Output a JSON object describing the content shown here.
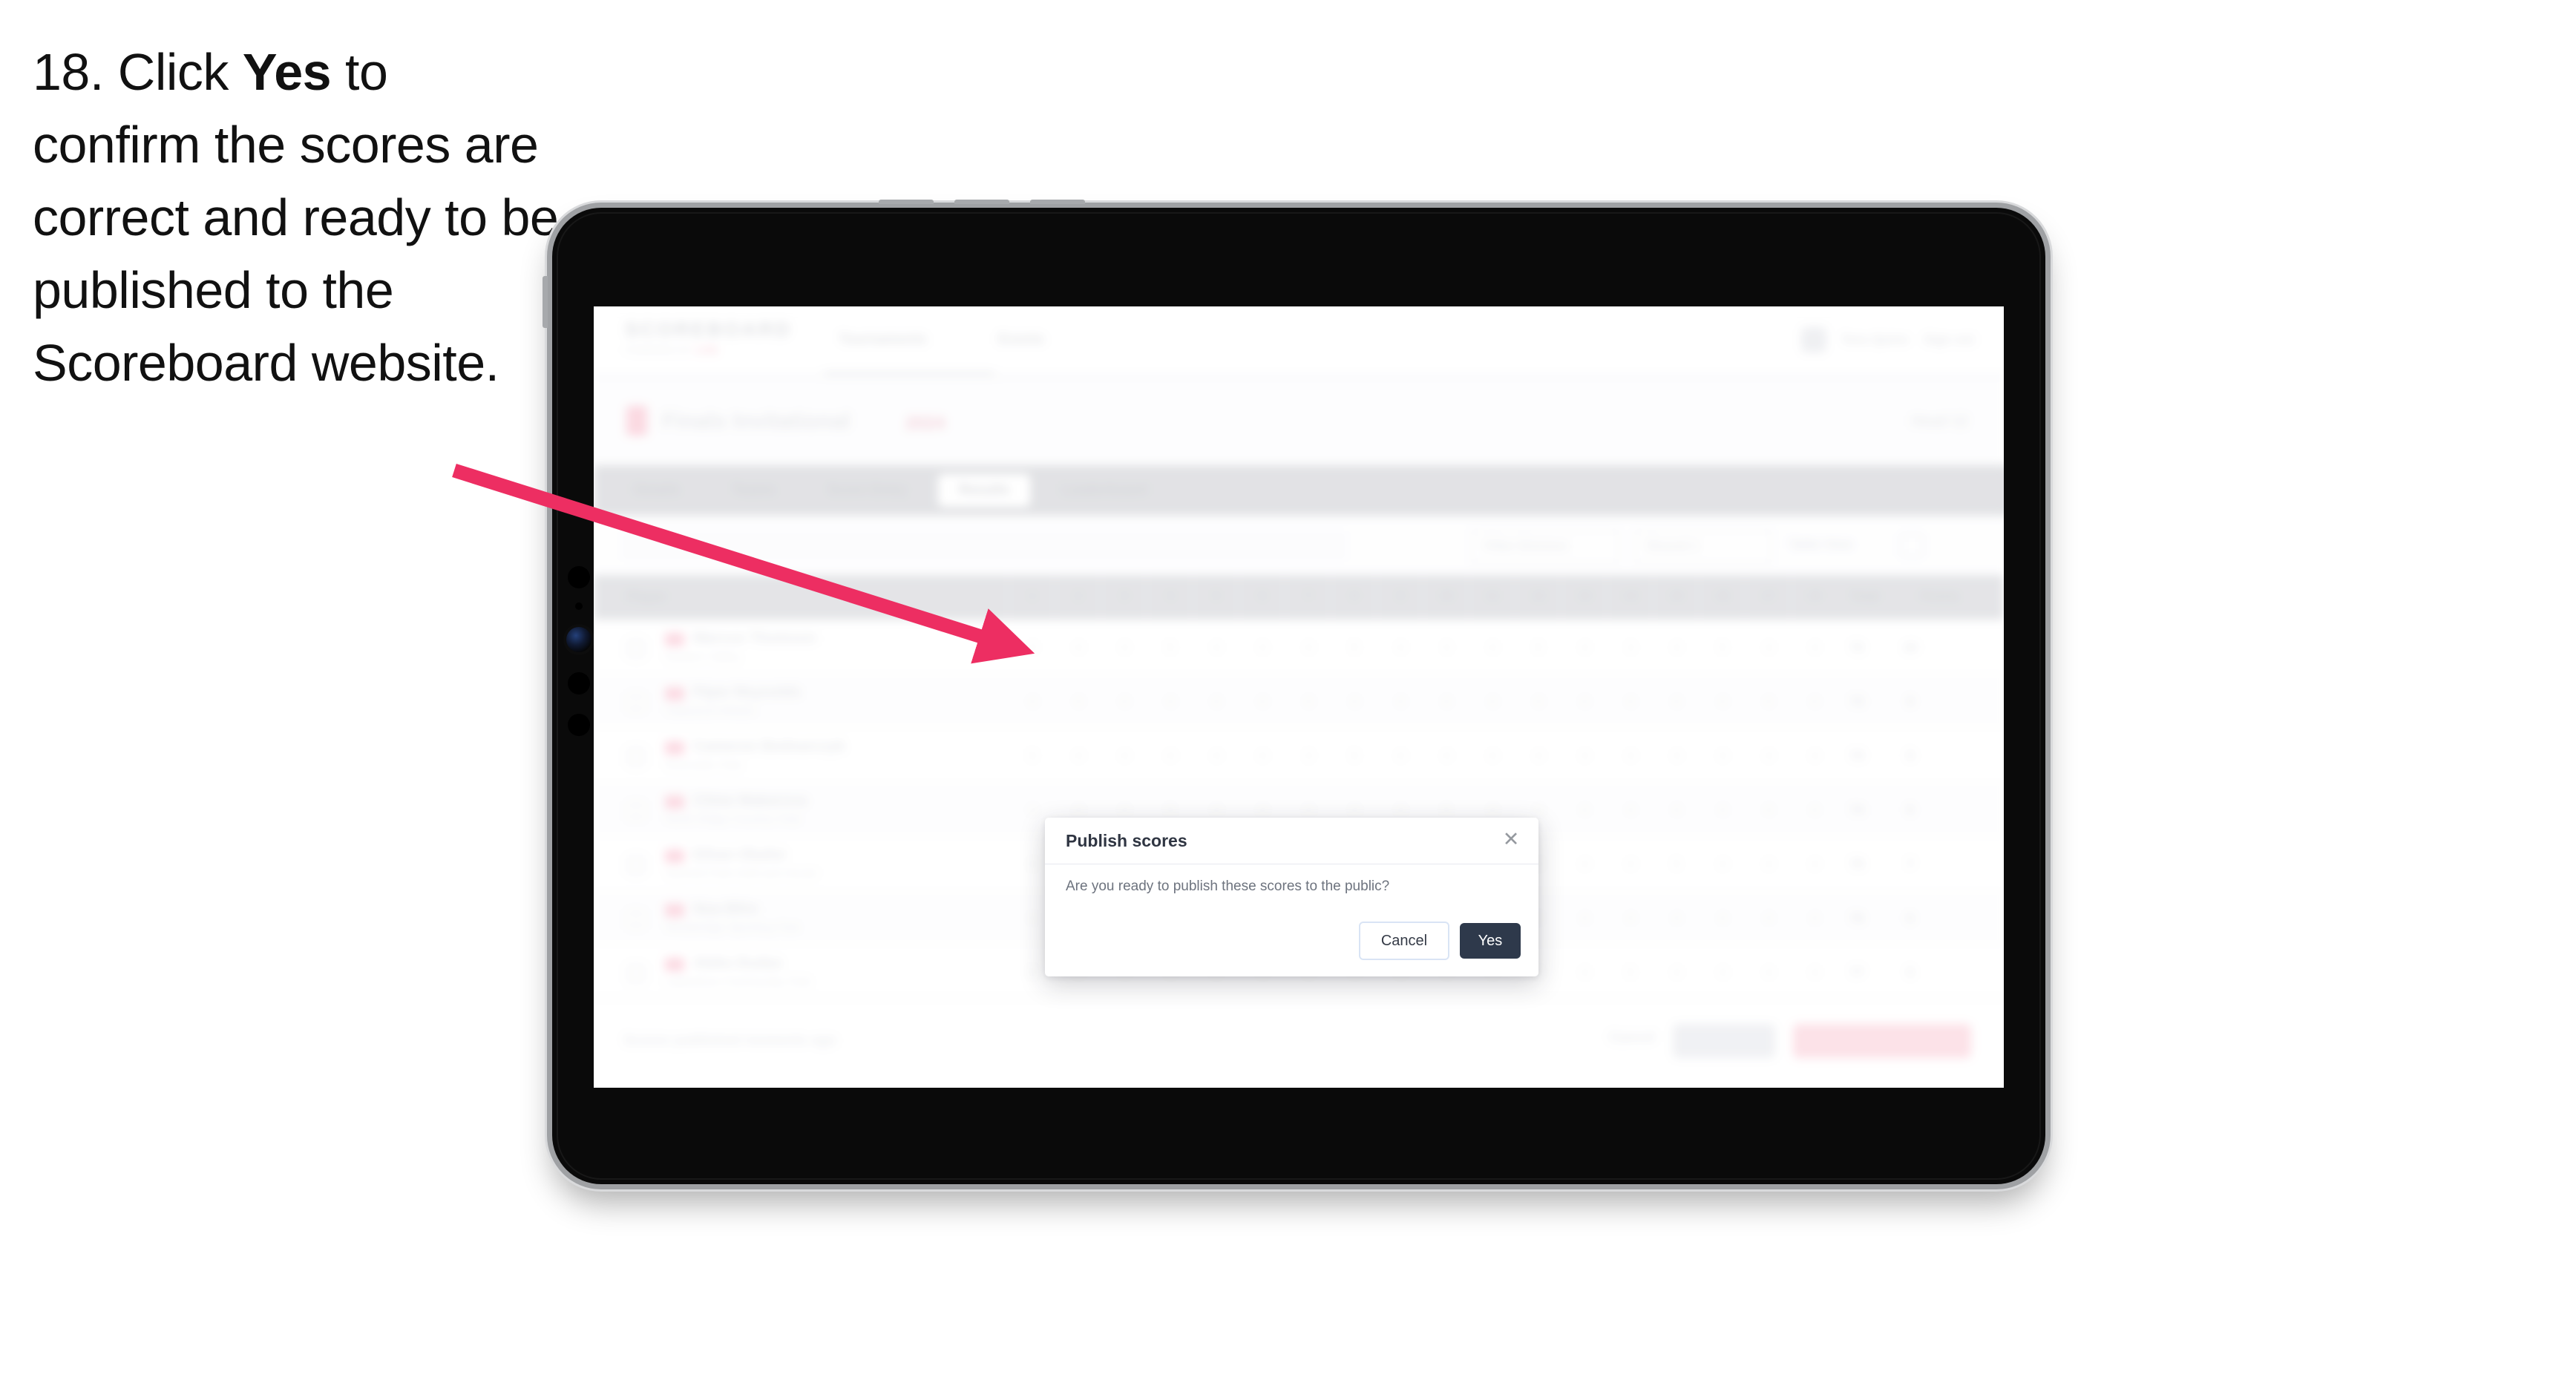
{
  "instruction": {
    "number": "18.",
    "text_before": "Click",
    "bold_word": "Yes",
    "text_after": "to confirm the scores are correct and ready to be published to the Scoreboard website."
  },
  "colors": {
    "arrow": "#ED2E62",
    "dialog_primary_button": "#2E394B",
    "dialog_cancel_border": "#D9E4F5",
    "brand_pink": "#F06292",
    "tablet_body": "#0A0A0A",
    "tablet_bezel": "#9FA1A4"
  },
  "device": {
    "name": "tablet-device",
    "orientation": "landscape",
    "buttons": [
      "volume-up-button",
      "volume-down-button",
      "power-button",
      "side-button"
    ],
    "sensors": [
      "front-camera",
      "ambient-light-sensor",
      "proximity-sensor"
    ]
  },
  "app": {
    "header": {
      "logo": "SCOREBOARD",
      "logo_sub": "POWERED BY",
      "logo_sub_accent": "LIVE",
      "nav": [
        {
          "label": "Tournaments"
        },
        {
          "label": "Events"
        }
      ],
      "user_name": "Tess Quinn",
      "sign_out": "Sign out",
      "avatar": "user-avatar"
    },
    "event": {
      "title": "Finals Invitational",
      "subtitle": "2024",
      "right_label": "Head 12"
    },
    "tabs": [
      {
        "label": "Details",
        "active": false
      },
      {
        "label": "Teams",
        "active": false
      },
      {
        "label": "Score Entry",
        "active": false
      },
      {
        "label": "Results",
        "active": true
      },
      {
        "label": "Leaderboard",
        "active": false
      }
    ],
    "filters": {
      "search_placeholder": "Search players",
      "selects": [
        {
          "label": "Filter Division"
        },
        {
          "label": "Round 1"
        }
      ],
      "view_toggle": "Table View",
      "view_icon": "grid-icon"
    },
    "table": {
      "columns_player": "Player",
      "score_columns": [
        "1",
        "2",
        "3",
        "4",
        "5",
        "6",
        "7",
        "8",
        "9",
        "10",
        "11",
        "12",
        "13",
        "14",
        "15",
        "16",
        "17",
        "18"
      ],
      "total_label": "Total",
      "points_label": "Points",
      "rows": [
        {
          "name": "Marcus Thomson",
          "club": "Eastern Valley",
          "scores": [
            "4",
            "4",
            "3",
            "5",
            "4",
            "3",
            "4",
            "5",
            "4",
            "3",
            "4",
            "5",
            "4",
            "3",
            "4",
            "5",
            "4",
            "4"
          ],
          "total": "72",
          "points": "10",
          "pill_a": "+2",
          "pill_b": "T1"
        },
        {
          "name": "Piper Reynolds",
          "club": "Oakwood Athletic",
          "scores": [
            "4",
            "4",
            "4",
            "4",
            "4",
            "4",
            "4",
            "4",
            "4",
            "4",
            "4",
            "4",
            "4",
            "4",
            "4",
            "4",
            "4",
            "4"
          ],
          "total": "73",
          "points": "9",
          "pill_a": "+3",
          "pill_b": "T2"
        },
        {
          "name": "Cameron Bednarczyk",
          "club": "Riverside Club",
          "scores": [
            "5",
            "4",
            "4",
            "4",
            "4",
            "4",
            "3",
            "5",
            "4",
            "4",
            "4",
            "4",
            "4",
            "4",
            "4",
            "4",
            "4",
            "4"
          ],
          "total": "73",
          "points": "9",
          "pill_a": "+3",
          "pill_b": "T2"
        },
        {
          "name": "Chloe Makarova",
          "club": "North Ridge Country Club",
          "scores": [
            "4",
            "4",
            "4",
            "5",
            "4",
            "4",
            "4",
            "4",
            "4",
            "5",
            "4",
            "4",
            "4",
            "4",
            "4",
            "4",
            "4",
            "4"
          ],
          "total": "74",
          "points": "8",
          "pill_a": "+4",
          "pill_b": "T4"
        },
        {
          "name": "Ethan Okafor",
          "club": "Summit Park Golf and Social",
          "scores": [
            "4",
            "5",
            "4",
            "4",
            "4",
            "4",
            "4",
            "4",
            "5",
            "4",
            "4",
            "4",
            "4",
            "4",
            "5",
            "4",
            "4",
            "4"
          ],
          "total": "75",
          "points": "7",
          "pill_a": "+5",
          "pill_b": "T5"
        },
        {
          "name": "Noa Bihn",
          "club": "Westbridge Sporting Club",
          "scores": [
            "4",
            "4",
            "5",
            "4",
            "4",
            "4",
            "4",
            "4",
            "4",
            "4",
            "4",
            "5",
            "4",
            "4",
            "4",
            "4",
            "4",
            "4"
          ],
          "total": "76",
          "points": "6",
          "pill_a": "+6",
          "pill_b": "T6"
        },
        {
          "name": "Aleks Dudas",
          "club": "Lakeshore Community Club",
          "scores": [
            "5",
            "4",
            "4",
            "4",
            "5",
            "4",
            "4",
            "4",
            "4",
            "4",
            "4",
            "4",
            "4",
            "5",
            "4",
            "4",
            "4",
            "4"
          ],
          "total": "77",
          "points": "5",
          "pill_a": "+7",
          "pill_b": "T7"
        }
      ]
    },
    "footer": {
      "note": "Scores published moments ago",
      "cancel": "Cancel",
      "secondary_label": "Save All",
      "primary_label": "Publish to Scoreboard"
    }
  },
  "dialog": {
    "title": "Publish scores",
    "body": "Are you ready to publish these scores to the public?",
    "cancel_label": "Cancel",
    "confirm_label": "Yes",
    "close_icon": "close-icon",
    "close_glyph": "✕"
  }
}
